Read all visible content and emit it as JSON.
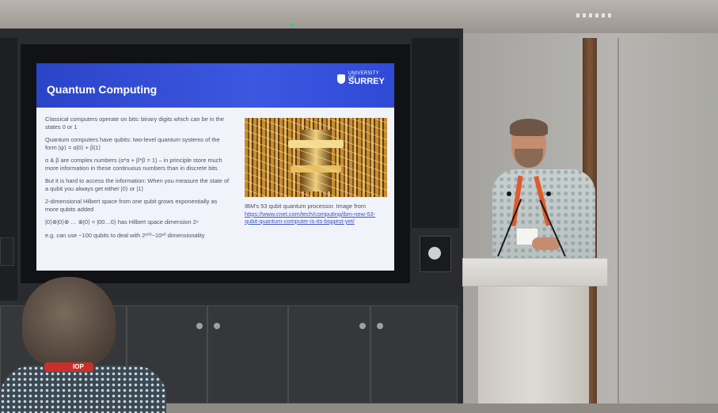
{
  "slide": {
    "title": "Quantum Computing",
    "logo_small": "UNIVERSITY OF",
    "logo_big": "SURREY",
    "paragraphs": [
      "Classical computers operate on bits: binary digits which can be in the states 0 or 1",
      "Quantum computers have qubits: two-level quantum systems of the form |ψ⟩ = α|0⟩ + β|1⟩",
      "α & β are complex numbers (α*α + β*β = 1) – in principle store much more information in these continuous numbers than in discrete bits",
      "But it is hard to access the information: When you measure the state of a qubit you always get either |0⟩ or |1⟩",
      "2-dimensional Hilbert space from one qubit grows exponentially as more qubits added",
      "|0⟩⊗|0⟩⊗ … ⊗|0⟩ = |00…0⟩ has Hilbert space dimension 2ⁿ",
      "e.g. can use ~100 qubits to deal with 2¹⁰⁰~10³⁰ dimensionality"
    ],
    "caption": "IBM's 53 qubit quantum processor. Image from",
    "caption_link": "https://www.cnet.com/tech/computing/ibm-new-53-qubit-quantum-computer-is-its-biggest-yet/"
  },
  "audience_lanyard_text": "IOP",
  "icons": {
    "logo": "university-crest-icon",
    "camera": "camera-icon",
    "microphone": "microphone-icon"
  }
}
